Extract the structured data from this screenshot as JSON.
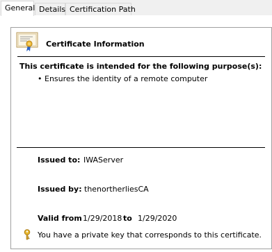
{
  "tabs": [
    {
      "label": "General"
    },
    {
      "label": "Details"
    },
    {
      "label": "Certification Path"
    }
  ],
  "header": {
    "title": "Certificate Information",
    "icon": "certificate-icon"
  },
  "purposes": {
    "heading": "This certificate is intended for the following purpose(s):",
    "items": [
      "Ensures the identity of a remote computer"
    ]
  },
  "fields": {
    "issued_to_label": "Issued to:",
    "issued_to_value": "IWAServer",
    "issued_by_label": "Issued by:",
    "issued_by_value": "thenortherliesCA",
    "valid_from_label": "Valid from",
    "valid_from_value": "1/29/2018",
    "valid_to_label": "to",
    "valid_to_value": "1/29/2020"
  },
  "private_key": {
    "text": "You have a private key that corresponds to this certificate.",
    "icon": "key-icon"
  }
}
